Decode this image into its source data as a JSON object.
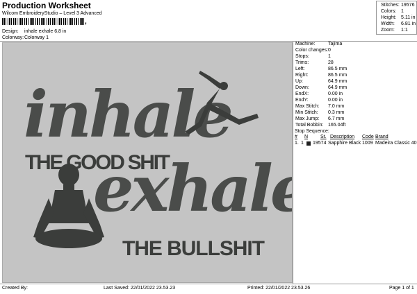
{
  "header": {
    "title": "Production Worksheet",
    "software": "Wilcom EmbroideryStudio – Level 3 Advanced",
    "barcode_suffix": ","
  },
  "design": {
    "design_label": "Design:",
    "design_value": "inhale exhale 6,8 in",
    "colorway_label": "Colorway:",
    "colorway_value": "Colorway 1"
  },
  "stats": {
    "stitches_label": "Stitches:",
    "stitches_value": "19576",
    "colors_label": "Colors:",
    "colors_value": "1",
    "height_label": "Height:",
    "height_value": "5.11 in",
    "width_label": "Width:",
    "width_value": "6.81 in",
    "zoom_label": "Zoom:",
    "zoom_value": "1:1"
  },
  "artwork": {
    "line1": "inhale",
    "line2": "THE GOOD SHIT",
    "line3": "exhale",
    "line4": "THE BULLSHIT",
    "thread_color": "#4a4c4a",
    "background": "#c4c4c4"
  },
  "machine_info": [
    {
      "label": "Machine:",
      "value": "Tajima"
    },
    {
      "label": "Color changes:",
      "value": "0"
    },
    {
      "label": "Stops:",
      "value": "1"
    },
    {
      "label": "Trims:",
      "value": "28"
    },
    {
      "label": "Left:",
      "value": "86.5 mm"
    },
    {
      "label": "Right:",
      "value": "86.5 mm"
    },
    {
      "label": "Up:",
      "value": "64.9 mm"
    },
    {
      "label": "Down:",
      "value": "64.9 mm"
    },
    {
      "label": "EndX:",
      "value": "0.00 in"
    },
    {
      "label": "EndY:",
      "value": "0.00 in"
    },
    {
      "label": "Max Stitch:",
      "value": "7.0 mm"
    },
    {
      "label": "Min Stitch:",
      "value": "0.3 mm"
    },
    {
      "label": "Max Jump:",
      "value": "6.7 mm"
    },
    {
      "label": "Total Bobbin:",
      "value": "165.04ft"
    }
  ],
  "stop_sequence": {
    "title": "Stop Sequence:",
    "headers": {
      "n": "#",
      "n_col": "N",
      "st": "St.",
      "description": "Description",
      "code": "Code",
      "brand": "Brand"
    },
    "rows": [
      {
        "index": "1.",
        "n": "1",
        "stitches": "19574",
        "description": "Sapphire Black",
        "code": "1009",
        "brand": "Madeira Classic 40",
        "color": "#1f1f1f"
      }
    ]
  },
  "footer": {
    "created_by": "Created By:",
    "last_saved": "Last Saved: 22/01/2022 23.53.23",
    "printed": "Printed: 22/01/2022 23.53.26",
    "page": "Page 1 of 1"
  }
}
